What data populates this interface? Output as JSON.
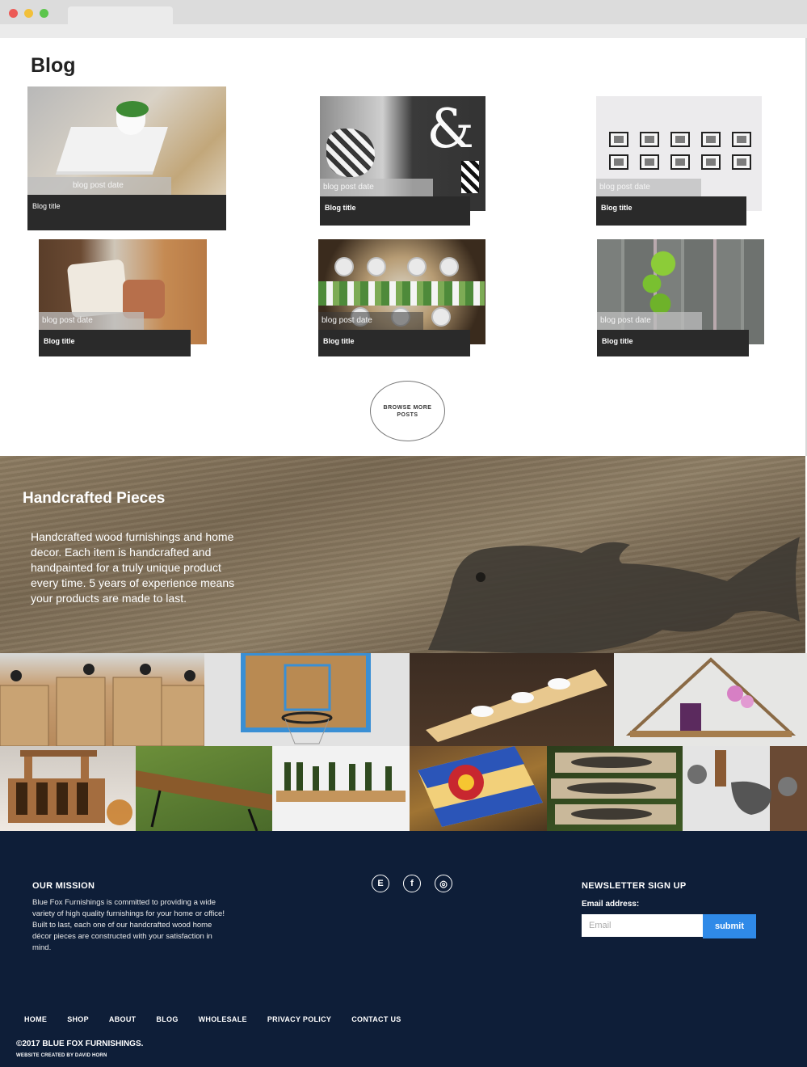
{
  "blog": {
    "heading": "Blog",
    "posts": [
      {
        "date": "blog post date",
        "title": "Blog title"
      },
      {
        "date": "blog post date",
        "title": "Blog title"
      },
      {
        "date": "blog post date",
        "title": "Blog title"
      },
      {
        "date": "blog post date",
        "title": "Blog title"
      },
      {
        "date": "blog post date",
        "title": "Blog title"
      },
      {
        "date": "blog post date",
        "title": "Blog title"
      }
    ],
    "browse_label": "BROWSE MORE POSTS"
  },
  "handcrafted": {
    "title": "Handcrafted Pieces",
    "text": "Handcrafted wood furnishings and home decor. Each item is handcrafted and handpainted for a truly unique product every time. 5 years of experience means your products are made to last."
  },
  "footer": {
    "mission_heading": "OUR MISSION",
    "mission_text": "Blue Fox Furnishings is committed to providing a wide variety of high quality furnishings for your home or office! Built to last, each one of our handcrafted wood home décor pieces are constructed with your satisfaction in mind.",
    "social": [
      {
        "icon": "etsy-icon",
        "glyph": "E"
      },
      {
        "icon": "facebook-icon",
        "glyph": "f"
      },
      {
        "icon": "instagram-icon",
        "glyph": "◎"
      }
    ],
    "newsletter_heading": "NEWSLETTER SIGN UP",
    "email_label": "Email address:",
    "email_placeholder": "Email",
    "submit_label": "submit",
    "nav": [
      "HOME",
      "SHOP",
      "ABOUT",
      "BLOG",
      "WHOLESALE",
      "PRIVACY POLICY",
      "CONTACT US"
    ],
    "copyright": "©2017 BLUE FOX FURNISHINGS.",
    "credit": "WEBSITE CREATED BY DAVID HORN"
  },
  "colors": {
    "footer_bg": "#0e1e38",
    "submit_bg": "#2f8ae8",
    "title_bar": "#2a2a2a"
  }
}
